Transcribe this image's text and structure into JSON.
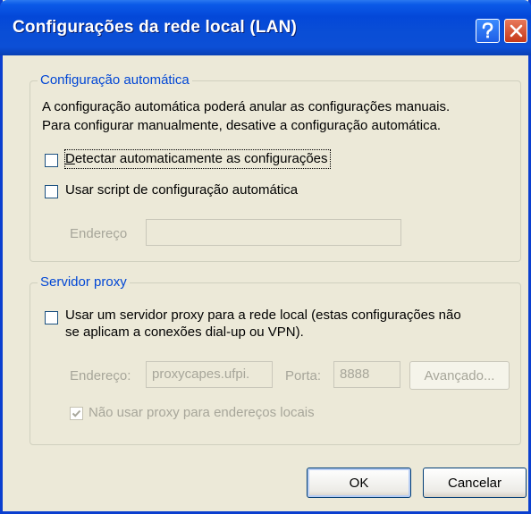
{
  "window": {
    "title": "Configurações da rede local (LAN)",
    "help_icon": "question-mark-icon",
    "close_icon": "close-x-icon"
  },
  "auto_config": {
    "legend": "Configuração automática",
    "description_line1": "A configuração automática poderá anular as configurações manuais.",
    "description_line2": "Para configurar manualmente, desative a configuração automática.",
    "detect_checkbox": {
      "label": "Detectar automaticamente as configurações",
      "checked": false
    },
    "script_checkbox": {
      "label": "Usar script de configuração automática",
      "checked": false
    },
    "address_label": "Endereço",
    "address_value": ""
  },
  "proxy": {
    "legend": "Servidor proxy",
    "use_proxy_checkbox": {
      "label_line1": "Usar um servidor proxy para a rede local (estas configurações não",
      "label_line2": "se aplicam a conexões dial-up ou VPN).",
      "checked": false
    },
    "address_label": "Endereço:",
    "address_value": "proxycapes.ufpi.",
    "port_label": "Porta:",
    "port_value": "8888",
    "advanced_button": "Avançado...",
    "bypass_checkbox": {
      "label": "Não usar proxy para endereços locais",
      "checked": true
    }
  },
  "buttons": {
    "ok": "OK",
    "cancel": "Cancelar"
  },
  "colors": {
    "titlebar": "#0448d8",
    "dialog_bg": "#ece9d8",
    "group_label": "#0046d5",
    "disabled_text": "#a7a69a"
  }
}
